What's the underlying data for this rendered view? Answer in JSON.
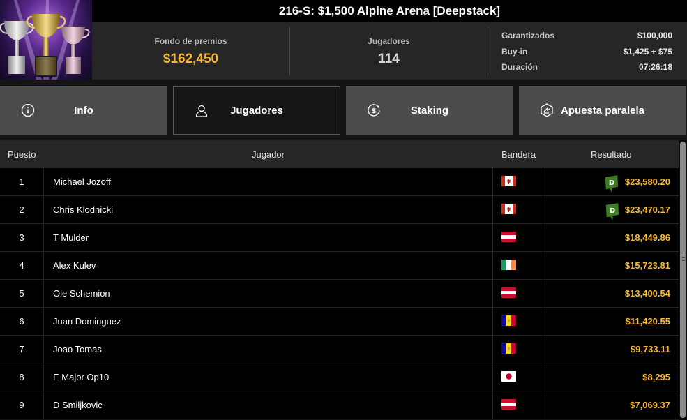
{
  "header": {
    "title": "216-S: $1,500 Alpine Arena [Deepstack]",
    "prize_label": "Fondo de premios",
    "prize_value": "$162,450",
    "players_label": "Jugadores",
    "players_value": "114",
    "details": [
      {
        "label": "Garantizados",
        "value": "$100,000"
      },
      {
        "label": "Buy-in",
        "value": "$1,425 + $75"
      },
      {
        "label": "Duración",
        "value": "07:26:18"
      }
    ]
  },
  "tabs": [
    {
      "label": "Info",
      "icon": "info-icon",
      "active": false
    },
    {
      "label": "Jugadores",
      "icon": "user-icon",
      "active": true
    },
    {
      "label": "Staking",
      "icon": "dollar-cycle-icon",
      "active": false
    },
    {
      "label": "Apuesta paralela",
      "icon": "side-bet-icon",
      "active": false
    }
  ],
  "table": {
    "headers": {
      "rank": "Puesto",
      "player": "Jugador",
      "flag": "Bandera",
      "result": "Resultado"
    },
    "rows": [
      {
        "rank": "1",
        "player": "Michael Jozoff",
        "flag": "canada",
        "result": "$23,580.20",
        "badge": "D"
      },
      {
        "rank": "2",
        "player": "Chris Klodnicki",
        "flag": "canada",
        "result": "$23,470.17",
        "badge": "D"
      },
      {
        "rank": "3",
        "player": "T Mulder",
        "flag": "austria",
        "result": "$18,449.86"
      },
      {
        "rank": "4",
        "player": "Alex Kulev",
        "flag": "ireland",
        "result": "$15,723.81"
      },
      {
        "rank": "5",
        "player": "Ole Schemion",
        "flag": "austria",
        "result": "$13,400.54"
      },
      {
        "rank": "6",
        "player": "Juan Dominguez",
        "flag": "andorra",
        "result": "$11,420.55"
      },
      {
        "rank": "7",
        "player": "Joao Tomas",
        "flag": "andorra",
        "result": "$9,733.11"
      },
      {
        "rank": "8",
        "player": "E Major Op10",
        "flag": "japan",
        "result": "$8,295"
      },
      {
        "rank": "9",
        "player": "D Smiljkovic",
        "flag": "austria",
        "result": "$7,069.37"
      }
    ]
  },
  "colors": {
    "accent": "#f7b733",
    "badge_green": "#3e7d24"
  }
}
